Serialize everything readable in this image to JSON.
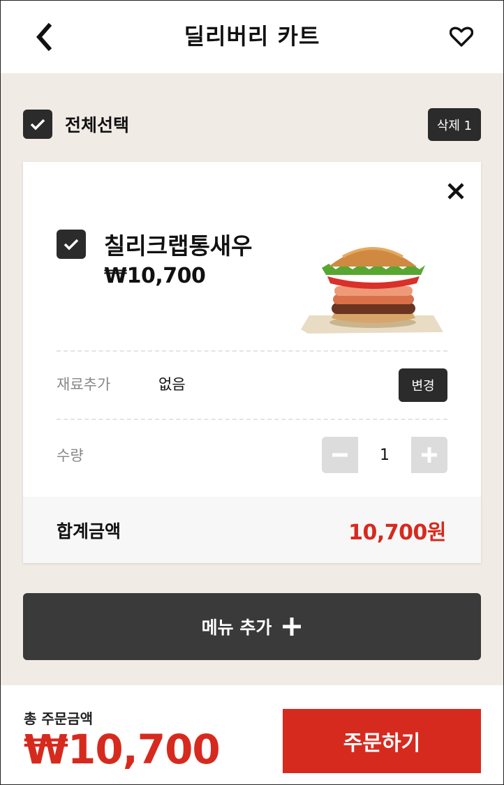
{
  "header": {
    "title": "딜리버리 카트",
    "back_icon": "chevron-left-icon",
    "favorite_icon": "heart-outline-icon"
  },
  "select_all": {
    "label": "전체선택",
    "checked": true,
    "delete_label": "삭제 1"
  },
  "cart_item": {
    "name": "칠리크랩통새우",
    "price": "₩10,700",
    "checked": true,
    "options": {
      "label": "재료추가",
      "value": "없음",
      "change_label": "변경"
    },
    "quantity": {
      "label": "수량",
      "value": "1"
    },
    "total": {
      "label": "합계금액",
      "value": "10,700원"
    }
  },
  "add_menu": {
    "label": "메뉴 추가"
  },
  "footer": {
    "order_total_label": "총 주문금액",
    "order_total_value": "₩10,700",
    "order_button_label": "주문하기"
  },
  "colors": {
    "accent_red": "#d62a1e",
    "dark": "#2b2b2b",
    "background": "#f1ebe6"
  }
}
